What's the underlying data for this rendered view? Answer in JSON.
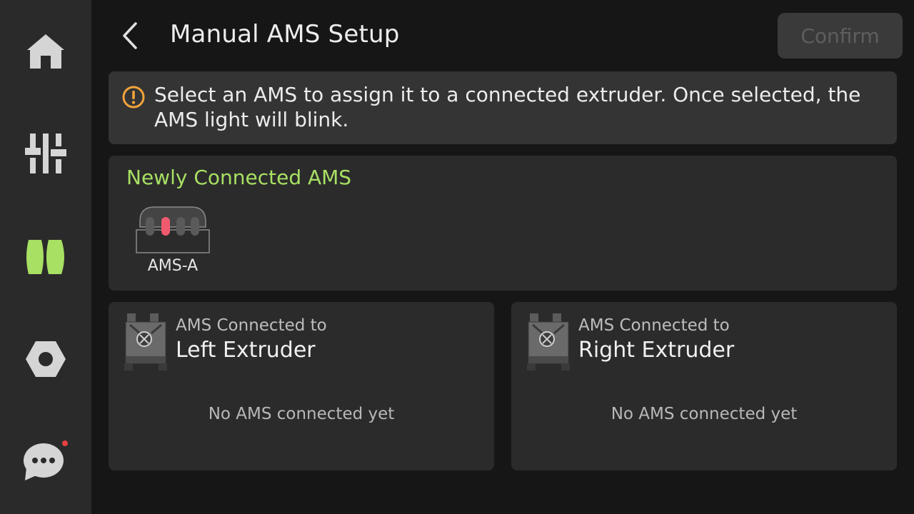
{
  "sidebar": {
    "items": [
      {
        "id": "home",
        "icon": "home-icon",
        "active": false
      },
      {
        "id": "controls",
        "icon": "sliders-icon",
        "active": false
      },
      {
        "id": "filament",
        "icon": "filament-spool-icon",
        "active": true
      },
      {
        "id": "settings",
        "icon": "hex-nut-settings-icon",
        "active": false
      },
      {
        "id": "messages",
        "icon": "chat-bubble-icon",
        "active": false,
        "has_notification": true
      }
    ]
  },
  "header": {
    "title": "Manual AMS Setup",
    "confirm_label": "Confirm",
    "confirm_enabled": false
  },
  "info_banner": {
    "icon": "info-circle-icon",
    "text": "Select an AMS to assign it to a connected extruder. Once selected, the AMS light will blink."
  },
  "new_ams_section": {
    "title": "Newly Connected AMS",
    "units": [
      {
        "label": "AMS-A",
        "active_slot": 2,
        "slot_count": 4
      }
    ]
  },
  "extruders": [
    {
      "caption": "AMS Connected to",
      "name": "Left Extruder",
      "empty_text": "No AMS connected yet"
    },
    {
      "caption": "AMS Connected to",
      "name": "Right Extruder",
      "empty_text": "No AMS connected yet"
    }
  ],
  "colors": {
    "accent_green": "#a8e063",
    "warning_orange": "#f3a33a",
    "active_slot_red": "#f05a6e",
    "notification_red": "#e84040"
  }
}
